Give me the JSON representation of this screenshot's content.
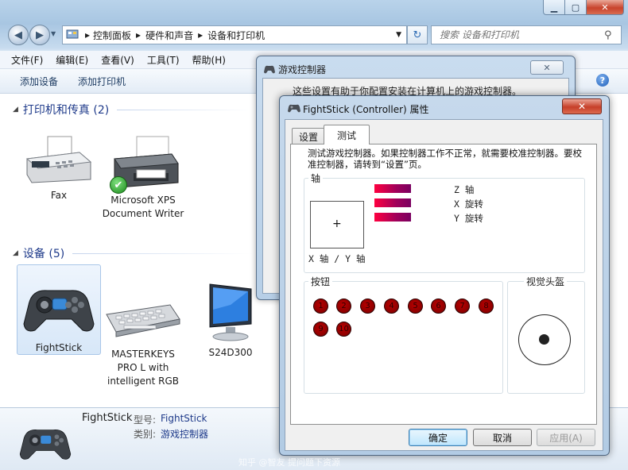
{
  "explorer": {
    "breadcrumb": [
      "控制面板",
      "硬件和声音",
      "设备和打印机"
    ],
    "search_placeholder": "搜索 设备和打印机",
    "menu": [
      "文件(F)",
      "编辑(E)",
      "查看(V)",
      "工具(T)",
      "帮助(H)"
    ],
    "toolbar": [
      "添加设备",
      "添加打印机"
    ],
    "groups": {
      "printers": "打印机和传真 (2)",
      "devices": "设备 (5)"
    },
    "printers": [
      {
        "label": "Fax"
      },
      {
        "label": "Microsoft XPS Document Writer"
      }
    ],
    "devices": [
      {
        "label": "FightStick"
      },
      {
        "label": "MASTERKEYS PRO L with intelligent RGB"
      },
      {
        "label": "S24D300"
      }
    ],
    "details": {
      "name": "FightStick",
      "model_key": "型号:",
      "model_val": "FightStick",
      "category_key": "类别:",
      "category_val": "游戏控制器"
    }
  },
  "game_controllers": {
    "title": "游戏控制器",
    "desc": "这些设置有助于你配置安装在计算机上的游戏控制器。"
  },
  "properties": {
    "title": "FightStick (Controller) 属性",
    "tabs": [
      "设置",
      "测试"
    ],
    "active_tab": "测试",
    "test_desc": "测试游戏控制器。如果控制器工作不正常，就需要校准控制器。要校准控制器，请转到“设置”页。",
    "axis_group": "轴",
    "xy_caption": "X 轴 / Y 轴",
    "axes": [
      "Z 轴",
      "X 旋转",
      "Y 旋转"
    ],
    "buttons_group": "按钮",
    "buttons": [
      "1",
      "2",
      "3",
      "4",
      "5",
      "6",
      "7",
      "8",
      "9",
      "10"
    ],
    "pov_group": "视觉头盔",
    "ok": "确定",
    "cancel": "取消",
    "apply": "应用(A)"
  },
  "watermark": "知乎 @智友 提问题下资源"
}
